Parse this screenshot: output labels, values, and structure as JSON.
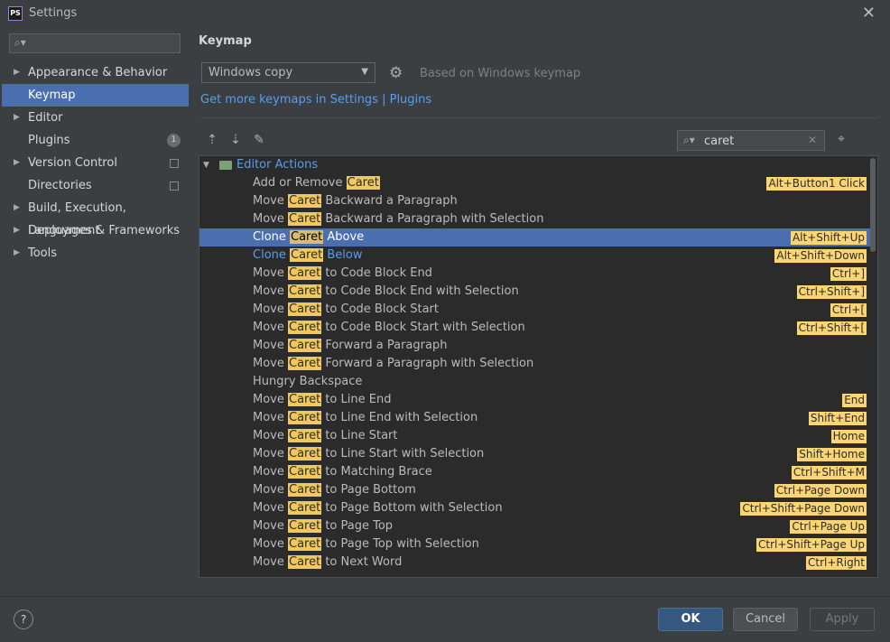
{
  "window": {
    "title": "Settings",
    "app_icon": "PS"
  },
  "sidebar": {
    "search_placeholder": "",
    "items": [
      {
        "label": "Appearance & Behavior",
        "expandable": true
      },
      {
        "label": "Keymap",
        "selected": true
      },
      {
        "label": "Editor",
        "expandable": true
      },
      {
        "label": "Plugins",
        "badge": "1"
      },
      {
        "label": "Version Control",
        "expandable": true
      },
      {
        "label": "Directories"
      },
      {
        "label": "Build, Execution, Deployment",
        "expandable": true
      },
      {
        "label": "Languages & Frameworks",
        "expandable": true
      },
      {
        "label": "Tools",
        "expandable": true
      }
    ]
  },
  "main": {
    "heading": "Keymap",
    "keymap_select": "Windows copy",
    "based_on": "Based on Windows keymap",
    "link_prefix": "Get more keymaps in Settings | Plugins",
    "search_value": "caret",
    "tree_root": "Editor Actions",
    "rows": [
      {
        "pre": "Add or Remove ",
        "hl": "Caret",
        "post": "",
        "shortcut": "Alt+Button1 Click"
      },
      {
        "pre": "Move ",
        "hl": "Caret",
        "post": " Backward a Paragraph",
        "shortcut": ""
      },
      {
        "pre": "Move ",
        "hl": "Caret",
        "post": " Backward a Paragraph with Selection",
        "shortcut": ""
      },
      {
        "pre": "Clone ",
        "hl": "Caret",
        "post": " Above",
        "shortcut": "Alt+Shift+Up",
        "selected": true
      },
      {
        "pre": "Clone ",
        "hl": "Caret",
        "post": " Below",
        "shortcut": "Alt+Shift+Down",
        "blue": true
      },
      {
        "pre": "Move ",
        "hl": "Caret",
        "post": " to Code Block End",
        "shortcut": "Ctrl+]"
      },
      {
        "pre": "Move ",
        "hl": "Caret",
        "post": " to Code Block End with Selection",
        "shortcut": "Ctrl+Shift+]"
      },
      {
        "pre": "Move ",
        "hl": "Caret",
        "post": " to Code Block Start",
        "shortcut": "Ctrl+["
      },
      {
        "pre": "Move ",
        "hl": "Caret",
        "post": " to Code Block Start with Selection",
        "shortcut": "Ctrl+Shift+["
      },
      {
        "pre": "Move ",
        "hl": "Caret",
        "post": " Forward a Paragraph",
        "shortcut": ""
      },
      {
        "pre": "Move ",
        "hl": "Caret",
        "post": " Forward a Paragraph with Selection",
        "shortcut": ""
      },
      {
        "pre": "Hungry Backspace",
        "hl": "",
        "post": "",
        "shortcut": ""
      },
      {
        "pre": "Move ",
        "hl": "Caret",
        "post": " to Line End",
        "shortcut": "End"
      },
      {
        "pre": "Move ",
        "hl": "Caret",
        "post": " to Line End with Selection",
        "shortcut": "Shift+End"
      },
      {
        "pre": "Move ",
        "hl": "Caret",
        "post": " to Line Start",
        "shortcut": "Home"
      },
      {
        "pre": "Move ",
        "hl": "Caret",
        "post": " to Line Start with Selection",
        "shortcut": "Shift+Home"
      },
      {
        "pre": "Move ",
        "hl": "Caret",
        "post": " to Matching Brace",
        "shortcut": "Ctrl+Shift+M"
      },
      {
        "pre": "Move ",
        "hl": "Caret",
        "post": " to Page Bottom",
        "shortcut": "Ctrl+Page Down"
      },
      {
        "pre": "Move ",
        "hl": "Caret",
        "post": " to Page Bottom with Selection",
        "shortcut": "Ctrl+Shift+Page Down"
      },
      {
        "pre": "Move ",
        "hl": "Caret",
        "post": " to Page Top",
        "shortcut": "Ctrl+Page Up"
      },
      {
        "pre": "Move ",
        "hl": "Caret",
        "post": " to Page Top with Selection",
        "shortcut": "Ctrl+Shift+Page Up"
      },
      {
        "pre": "Move ",
        "hl": "Caret",
        "post": " to Next Word",
        "shortcut": "Ctrl+Right"
      }
    ]
  },
  "buttons": {
    "ok": "OK",
    "cancel": "Cancel",
    "apply": "Apply",
    "help": "?"
  },
  "colors": {
    "selection": "#4b6eaf",
    "highlight": "#f1c75f",
    "link": "#589df6"
  }
}
